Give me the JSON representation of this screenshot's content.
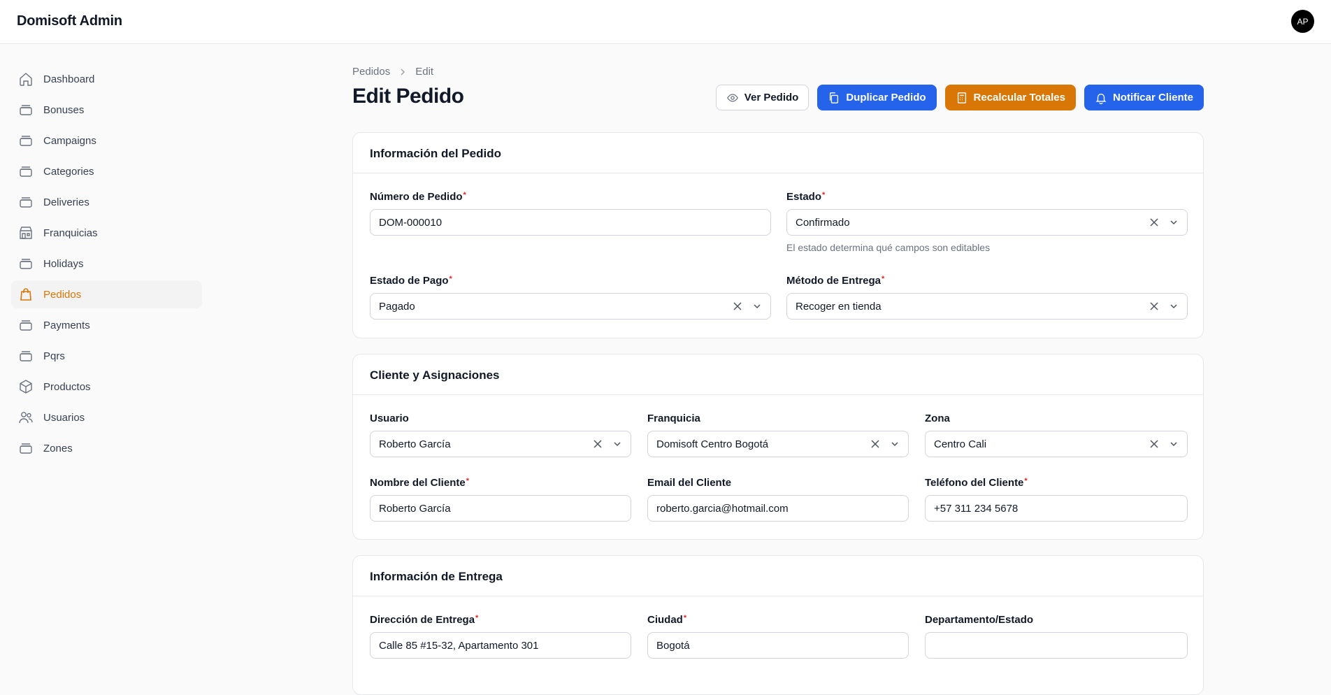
{
  "app": {
    "title": "Domisoft Admin",
    "avatar_initials": "AP"
  },
  "sidebar": {
    "items": [
      {
        "label": "Dashboard",
        "icon": "home-icon"
      },
      {
        "label": "Bonuses",
        "icon": "stack-icon"
      },
      {
        "label": "Campaigns",
        "icon": "stack-icon"
      },
      {
        "label": "Categories",
        "icon": "stack-icon"
      },
      {
        "label": "Deliveries",
        "icon": "stack-icon"
      },
      {
        "label": "Franquicias",
        "icon": "building-store-icon"
      },
      {
        "label": "Holidays",
        "icon": "stack-icon"
      },
      {
        "label": "Pedidos",
        "icon": "shopping-bag-icon",
        "active": true
      },
      {
        "label": "Payments",
        "icon": "stack-icon"
      },
      {
        "label": "Pqrs",
        "icon": "stack-icon"
      },
      {
        "label": "Productos",
        "icon": "cube-icon"
      },
      {
        "label": "Usuarios",
        "icon": "users-icon"
      },
      {
        "label": "Zones",
        "icon": "stack-icon"
      }
    ]
  },
  "breadcrumb": {
    "parent": "Pedidos",
    "current": "Edit"
  },
  "page": {
    "title": "Edit Pedido"
  },
  "actions": {
    "view": "Ver Pedido",
    "duplicate": "Duplicar Pedido",
    "recalculate": "Recalcular Totales",
    "notify": "Notificar Cliente"
  },
  "colors": {
    "primary": "#2563eb",
    "warning": "#d97706",
    "active_nav": "#d97706",
    "required": "#dc2626"
  },
  "sections": {
    "order_info": {
      "title": "Información del Pedido",
      "order_number": {
        "label": "Número de Pedido",
        "value": "DOM-000010"
      },
      "status": {
        "label": "Estado",
        "value": "Confirmado",
        "help": "El estado determina qué campos son editables"
      },
      "payment_status": {
        "label": "Estado de Pago",
        "value": "Pagado"
      },
      "delivery_method": {
        "label": "Método de Entrega",
        "value": "Recoger en tienda"
      }
    },
    "customer": {
      "title": "Cliente y Asignaciones",
      "user": {
        "label": "Usuario",
        "value": "Roberto García"
      },
      "franchise": {
        "label": "Franquicia",
        "value": "Domisoft Centro Bogotá"
      },
      "zone": {
        "label": "Zona",
        "value": "Centro Cali"
      },
      "customer_name": {
        "label": "Nombre del Cliente",
        "value": "Roberto García"
      },
      "customer_email": {
        "label": "Email del Cliente",
        "value": "roberto.garcia@hotmail.com"
      },
      "customer_phone": {
        "label": "Teléfono del Cliente",
        "value": "+57 311 234 5678"
      }
    },
    "delivery": {
      "title": "Información de Entrega",
      "address": {
        "label": "Dirección de Entrega",
        "value": "Calle 85 #15-32, Apartamento 301"
      },
      "city": {
        "label": "Ciudad",
        "value": "Bogotá"
      },
      "state": {
        "label": "Departamento/Estado",
        "value": ""
      }
    }
  }
}
